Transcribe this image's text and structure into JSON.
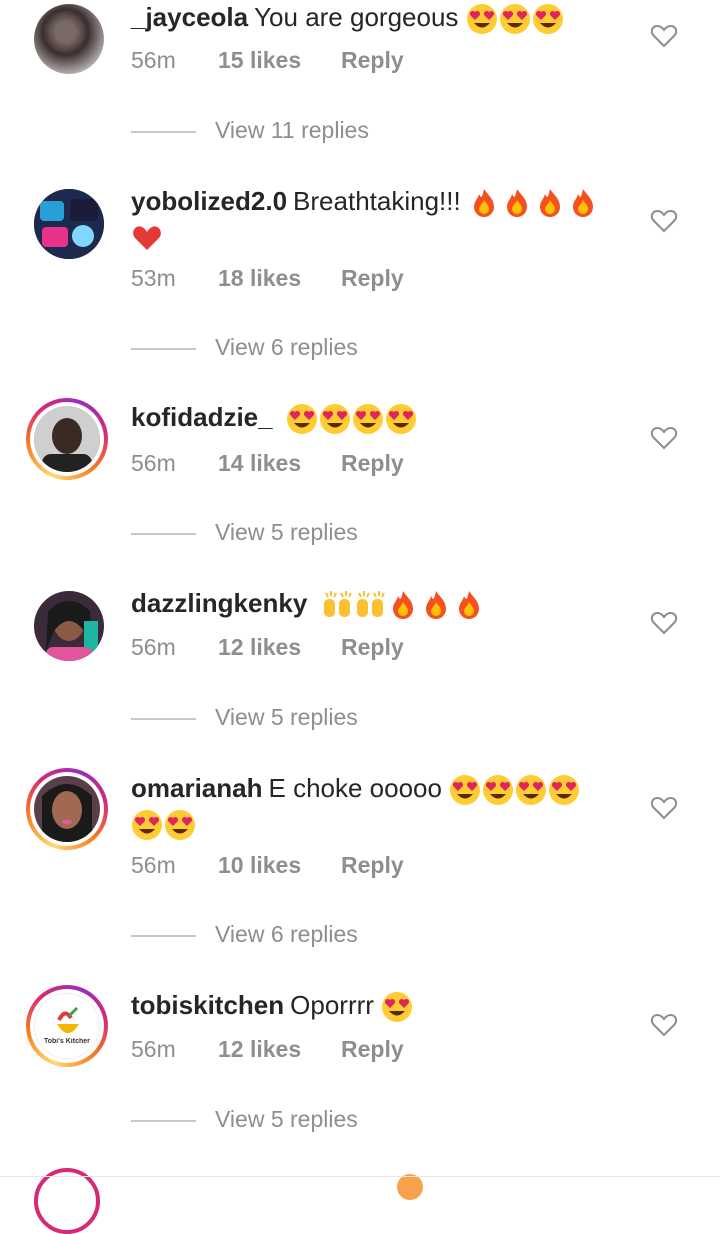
{
  "comments": [
    {
      "username": "_jayceola",
      "text": "You are gorgeous",
      "emoji": [
        "heart-eyes",
        "heart-eyes",
        "heart-eyes"
      ],
      "emoji2": [],
      "time": "56m",
      "likes": "15 likes",
      "reply": "Reply",
      "view_replies": "View 11 replies",
      "ring": false
    },
    {
      "username": "yobolized2.0",
      "text": "Breathtaking!!!",
      "emoji": [
        "fire",
        "fire",
        "fire",
        "fire"
      ],
      "emoji2": [
        "red-heart"
      ],
      "time": "53m",
      "likes": "18 likes",
      "reply": "Reply",
      "view_replies": "View 6 replies",
      "ring": false
    },
    {
      "username": "kofidadzie_",
      "text": "",
      "emoji": [
        "heart-eyes",
        "heart-eyes",
        "heart-eyes",
        "heart-eyes"
      ],
      "emoji2": [],
      "time": "56m",
      "likes": "14 likes",
      "reply": "Reply",
      "view_replies": "View 5 replies",
      "ring": true
    },
    {
      "username": "dazzlingkenky",
      "text": "",
      "emoji": [
        "raising-hands",
        "raising-hands",
        "fire",
        "fire",
        "fire"
      ],
      "emoji2": [],
      "time": "56m",
      "likes": "12 likes",
      "reply": "Reply",
      "view_replies": "View 5 replies",
      "ring": false
    },
    {
      "username": "omarianah",
      "text": "E choke ooooo",
      "emoji": [
        "heart-eyes",
        "heart-eyes",
        "heart-eyes",
        "heart-eyes"
      ],
      "emoji2": [
        "heart-eyes",
        "heart-eyes"
      ],
      "time": "56m",
      "likes": "10 likes",
      "reply": "Reply",
      "view_replies": "View 6 replies",
      "ring": true
    },
    {
      "username": "tobiskitchen",
      "text": "Oporrrr",
      "emoji": [
        "heart-eyes"
      ],
      "emoji2": [],
      "time": "56m",
      "likes": "12 likes",
      "reply": "Reply",
      "view_replies": "View 5 replies",
      "ring": true,
      "logo_text": "Tobi's Kitchen"
    }
  ],
  "icons": {
    "like": "heart-outline-icon"
  },
  "colors": {
    "text": "#262626",
    "secondary": "#8e8e8e",
    "divider": "#c7c7c7"
  }
}
